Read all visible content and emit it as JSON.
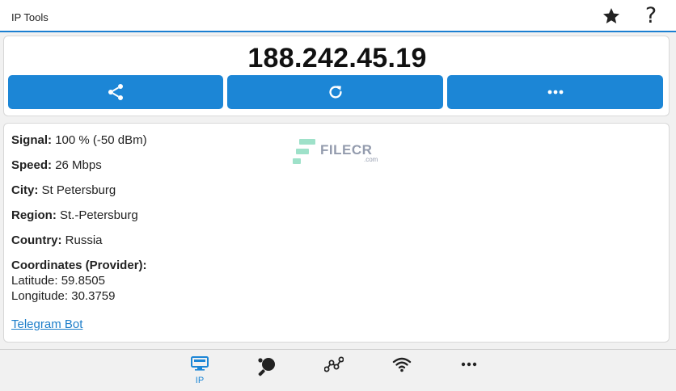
{
  "header": {
    "title": "IP Tools",
    "help_glyph": "?",
    "icons": [
      "star-icon",
      "help-icon"
    ]
  },
  "ip_panel": {
    "ip_address": "188.242.45.19",
    "buttons": [
      {
        "name": "share-button",
        "icon": "share-icon"
      },
      {
        "name": "refresh-button",
        "icon": "refresh-icon"
      },
      {
        "name": "more-button",
        "icon": "more-horizontal-icon"
      }
    ]
  },
  "info": {
    "signal_label": "Signal:",
    "signal_value": "100 % (-50 dBm)",
    "speed_label": "Speed:",
    "speed_value": "26 Mbps",
    "city_label": "City:",
    "city_value": "St Petersburg",
    "region_label": "Region:",
    "region_value": "St.-Petersburg",
    "country_label": "Country:",
    "country_value": "Russia",
    "coordinates_label": "Coordinates (Provider):",
    "latitude_label": "Latitude:",
    "latitude_value": "59.8505",
    "longitude_label": "Longitude:",
    "longitude_value": "30.3759",
    "telegram_link": "Telegram Bot"
  },
  "watermark": {
    "text": "FILECR",
    "suffix": ".com"
  },
  "bottom_nav": {
    "items": [
      {
        "name": "ip",
        "label": "IP",
        "icon": "monitor-icon",
        "active": true
      },
      {
        "name": "ping",
        "label": "",
        "icon": "ping-pong-icon"
      },
      {
        "name": "traceroute",
        "label": "",
        "icon": "network-nodes-icon"
      },
      {
        "name": "wifi",
        "label": "",
        "icon": "wifi-icon"
      },
      {
        "name": "more",
        "label": "",
        "icon": "more-horizontal-icon"
      }
    ]
  },
  "colors": {
    "accent": "#1c86d6",
    "link": "#1c7dc9",
    "background": "#f1f1f1",
    "card": "#ffffff"
  }
}
